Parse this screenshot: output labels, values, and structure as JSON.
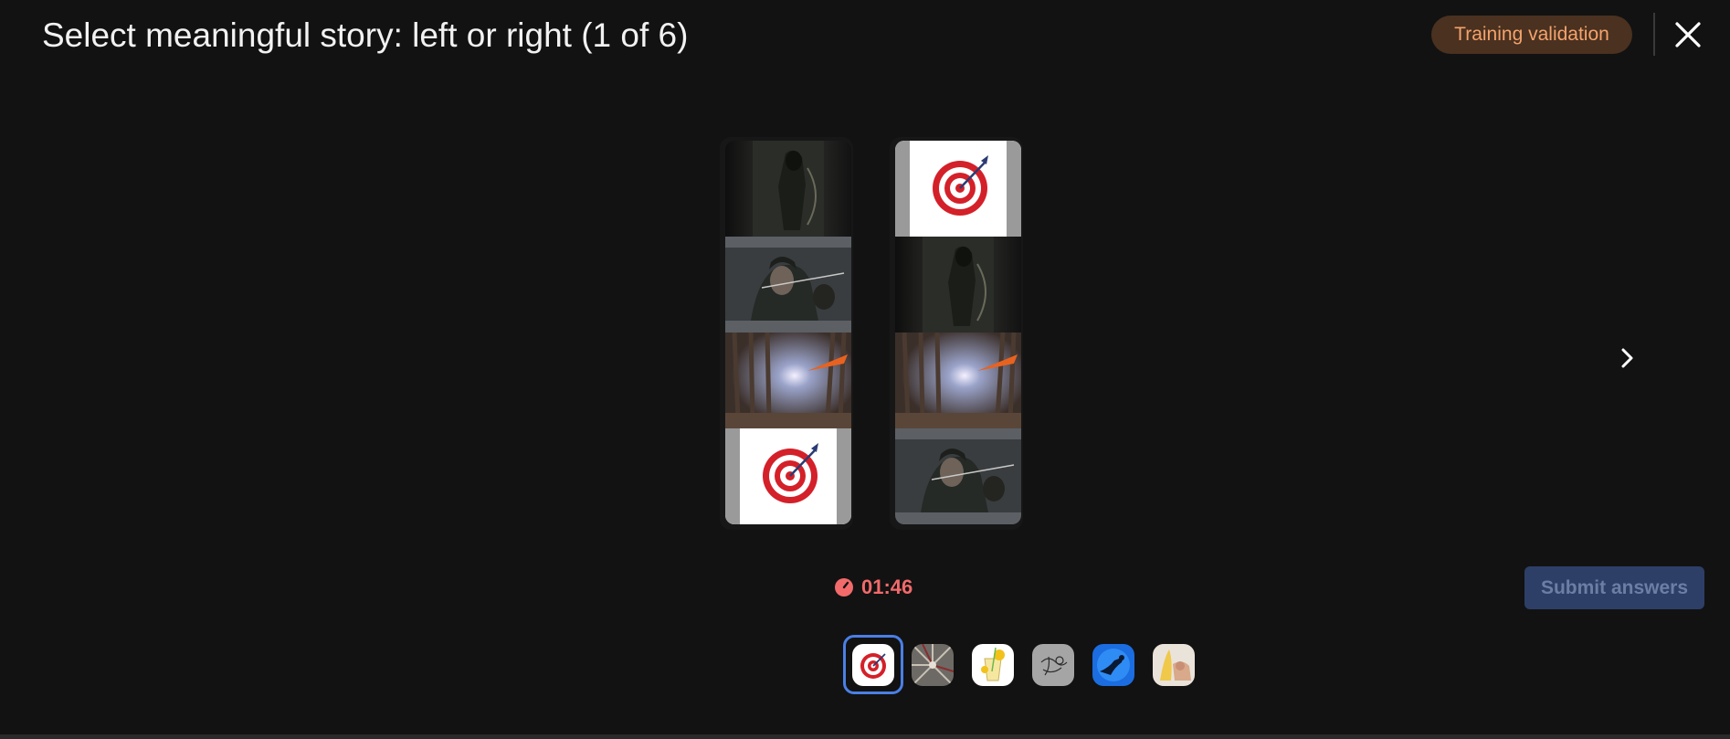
{
  "header": {
    "title": "Select meaningful story: left or right (1 of 6)",
    "badge": "Training validation",
    "close_icon": "close-icon"
  },
  "stories": [
    {
      "side": "left",
      "frames": [
        "hooded-archer-standing",
        "archer-drawing-bow",
        "arrow-flying-forest",
        "target-arrow-bullseye"
      ]
    },
    {
      "side": "right",
      "frames": [
        "target-arrow-bullseye",
        "hooded-archer-standing",
        "arrow-flying-forest",
        "archer-drawing-bow"
      ]
    }
  ],
  "navigation": {
    "next_icon": "chevron-right-icon"
  },
  "timer": {
    "icon": "stopwatch-icon",
    "value": "01:46",
    "color": "#f26a6a"
  },
  "actions": {
    "submit_label": "Submit answers"
  },
  "thumbnails": [
    {
      "name": "target",
      "selected": true
    },
    {
      "name": "tunnel",
      "selected": false
    },
    {
      "name": "lemonade",
      "selected": false
    },
    {
      "name": "sketch",
      "selected": false
    },
    {
      "name": "diver",
      "selected": false
    },
    {
      "name": "banana-hand",
      "selected": false
    }
  ],
  "colors": {
    "background": "#121212",
    "accent": "#4a7fe6",
    "badge_text": "#f4a36b",
    "badge_bg": "#4a3120"
  }
}
